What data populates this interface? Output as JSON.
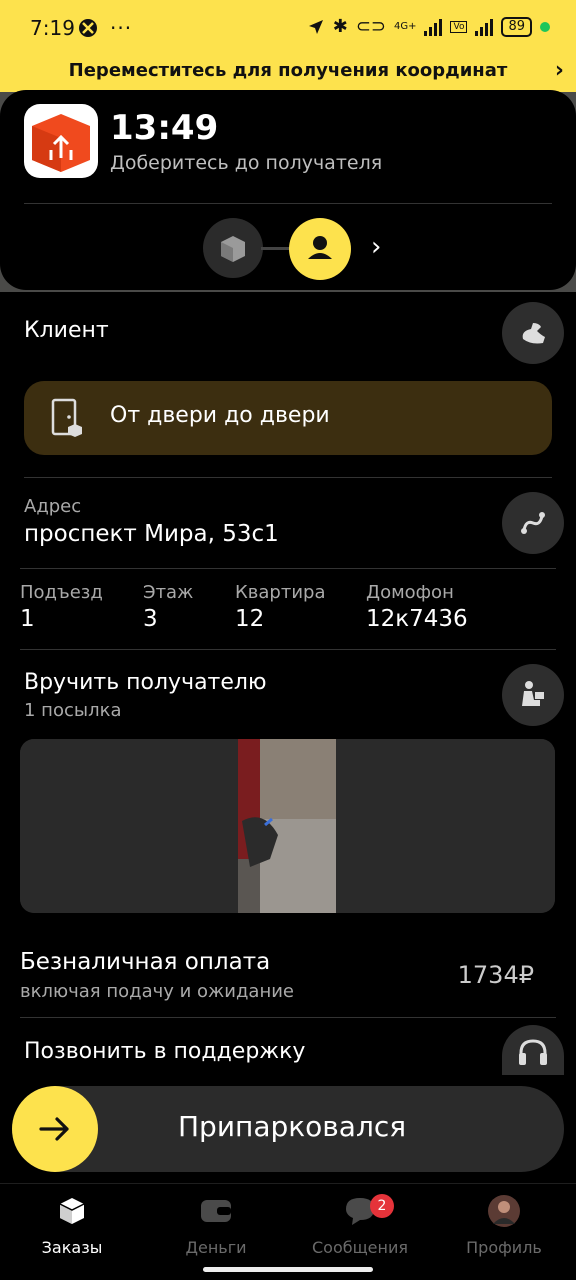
{
  "status_bar": {
    "time": "7:19",
    "battery": "89",
    "network_label": "4G+"
  },
  "banner": {
    "text": "Переместитесь для получения координат"
  },
  "order": {
    "eta": "13:49",
    "stage": "Доберитесь до получателя"
  },
  "client": {
    "title": "Клиент",
    "delivery_type": "От двери до двери"
  },
  "address": {
    "label": "Адрес",
    "value": "проспект Мира, 53с1",
    "details": [
      {
        "label": "Подъезд",
        "value": "1"
      },
      {
        "label": "Этаж",
        "value": "3"
      },
      {
        "label": "Квартира",
        "value": "12"
      },
      {
        "label": "Домофон",
        "value": "12к7436"
      }
    ]
  },
  "handover": {
    "title": "Вручить получателю",
    "count": "1 посылка"
  },
  "payment": {
    "title": "Безналичная оплата",
    "subtitle": "включая подачу и ожидание",
    "amount": "1734₽"
  },
  "support": {
    "label": "Позвонить в поддержку"
  },
  "action": {
    "label": "Припарковался"
  },
  "nav": {
    "items": [
      {
        "label": "Заказы",
        "active": true
      },
      {
        "label": "Деньги",
        "active": false
      },
      {
        "label": "Сообщения",
        "active": false,
        "badge": "2"
      },
      {
        "label": "Профиль",
        "active": false
      }
    ]
  },
  "colors": {
    "accent": "#fde24d",
    "badge": "#e5333a",
    "door_card": "#3c2e10"
  }
}
